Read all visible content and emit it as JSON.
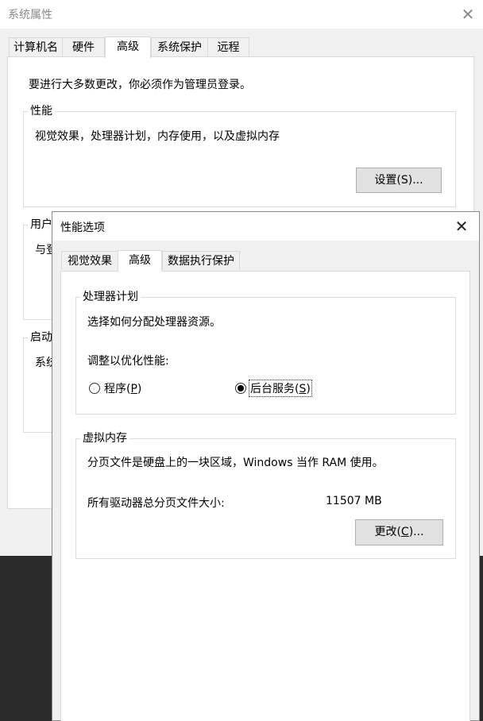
{
  "background_dialog": {
    "title": "系统属性",
    "tabs": [
      "计算机名",
      "硬件",
      "高级",
      "系统保护",
      "远程"
    ],
    "active_tab": "高级",
    "admin_notice": "要进行大多数更改，你必须作为管理员登录。",
    "performance": {
      "group_title": "性能",
      "description": "视觉效果，处理器计划，内存使用，以及虚拟内存",
      "settings_button": "设置(S)..."
    },
    "user_profiles": {
      "group_title_partial": "用户",
      "description_partial": "与登"
    },
    "startup": {
      "group_title_partial": "启动",
      "description_partial": "系统"
    }
  },
  "perf_dialog": {
    "title": "性能选项",
    "tabs": [
      "视觉效果",
      "高级",
      "数据执行保护"
    ],
    "active_tab": "高级",
    "processor_scheduling": {
      "group_title": "处理器计划",
      "description": "选择如何分配处理器资源。",
      "adjust_label": "调整以优化性能:",
      "programs_option": {
        "label": "程序",
        "accel": "P",
        "selected": false
      },
      "background_option": {
        "label": "后台服务",
        "accel": "S",
        "selected": true
      }
    },
    "virtual_memory": {
      "group_title": "虚拟内存",
      "description": "分页文件是硬盘上的一块区域，Windows 当作 RAM 使用。",
      "total_label": "所有驱动器总分页文件大小:",
      "total_value": "11507 MB",
      "change_button": {
        "label": "更改",
        "accel": "C",
        "suffix": "..."
      }
    }
  }
}
